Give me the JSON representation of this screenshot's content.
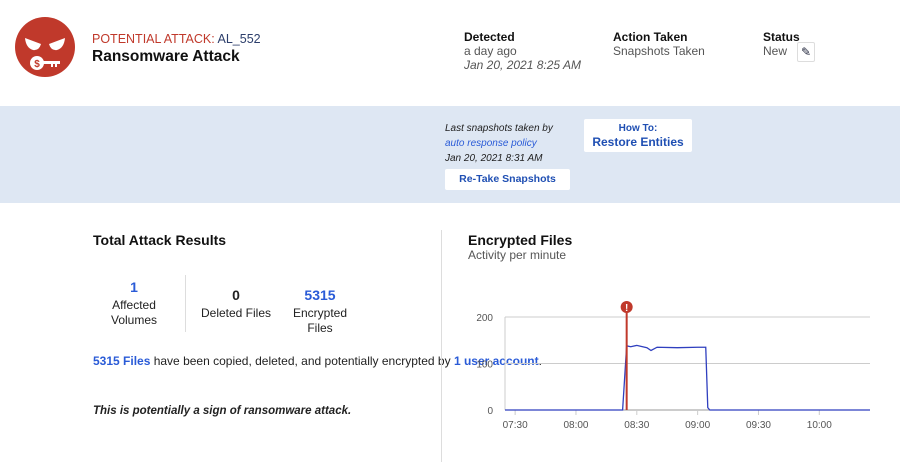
{
  "alert": {
    "label": "POTENTIAL ATTACK:",
    "id": "AL_552",
    "title": "Ransomware Attack",
    "icon": "ransomware-face-icon",
    "accent": "#c0392b"
  },
  "detected": {
    "label": "Detected",
    "relative": "a day ago",
    "time": "Jan 20, 2021 8:25 AM"
  },
  "action": {
    "label": "Action Taken",
    "value": "Snapshots Taken"
  },
  "status": {
    "label": "Status",
    "value": "New",
    "edit_icon": "pencil-icon"
  },
  "snapshots": {
    "line1": "Last snapshots taken by",
    "link": "auto response policy",
    "time": "Jan 20, 2021 8:31 AM",
    "retake": "Re-Take Snapshots",
    "howto_top": "How To:",
    "howto_bottom": "Restore Entities"
  },
  "results": {
    "title": "Total Attack Results",
    "stats": [
      {
        "value": "1",
        "label": "Affected Volumes"
      },
      {
        "value": "0",
        "label": "Deleted Files"
      },
      {
        "value": "5315",
        "label": "Encrypted Files"
      }
    ],
    "desc_files": "5315 Files",
    "desc_mid": " have been copied, deleted, and potentially encrypted by ",
    "desc_user": "1 user account",
    "desc_end": ".",
    "warning": "This is potentially a sign of ransomware attack."
  },
  "chart_data": {
    "type": "line",
    "title": "Encrypted Files",
    "subtitle": "Activity per minute",
    "xlim": [
      "07:25",
      "10:25"
    ],
    "ylim": [
      0,
      200
    ],
    "yticks": [
      0,
      100,
      200
    ],
    "xticks": [
      "07:30",
      "08:00",
      "08:30",
      "09:00",
      "09:30",
      "10:00"
    ],
    "alert_marker": "08:25",
    "grid": true,
    "line_color": "#2f3fbf",
    "marker_color": "#c0392b",
    "x": [
      "07:25",
      "08:23",
      "08:25",
      "08:27",
      "08:30",
      "08:35",
      "08:37",
      "08:40",
      "08:50",
      "09:00",
      "09:03",
      "09:04",
      "09:05",
      "09:06",
      "10:25"
    ],
    "y": [
      0,
      0,
      138,
      136,
      139,
      134,
      128,
      135,
      134,
      135,
      135,
      135,
      5,
      0,
      0
    ]
  }
}
